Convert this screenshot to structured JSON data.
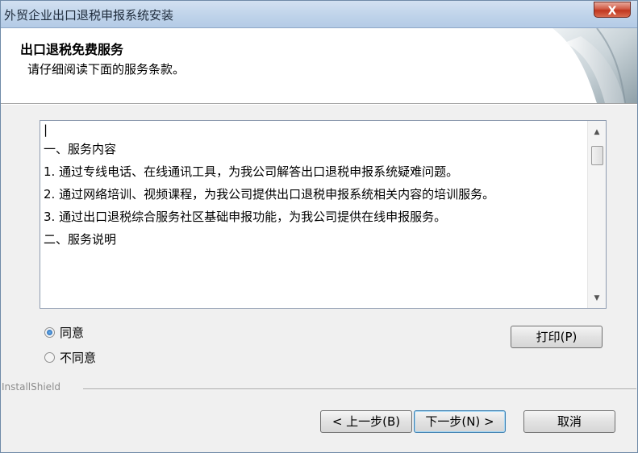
{
  "window": {
    "title": "外贸企业出口退税申报系统安装",
    "close_glyph": "X"
  },
  "header": {
    "title": "出口退税免费服务",
    "subtitle": "请仔细阅读下面的服务条款。"
  },
  "terms": {
    "caret": "|",
    "paragraphs": [
      "一、服务内容",
      "1. 通过专线电话、在线通讯工具，为我公司解答出口退税申报系统疑难问题。",
      "2. 通过网络培训、视频课程，为我公司提供出口退税申报系统相关内容的培训服务。",
      "3. 通过出口退税综合服务社区基础申报功能，为我公司提供在线申报服务。",
      "二、服务说明"
    ],
    "scroll_up_glyph": "▲",
    "scroll_down_glyph": "▼"
  },
  "options": {
    "agree_label": "同意",
    "disagree_label": "不同意",
    "selected": "agree"
  },
  "buttons": {
    "print_label": "打印(P)",
    "back_label": "< 上一步(B)",
    "next_label": "下一步(N) >",
    "cancel_label": "取消"
  },
  "footer": {
    "brand": "InstallShield"
  }
}
